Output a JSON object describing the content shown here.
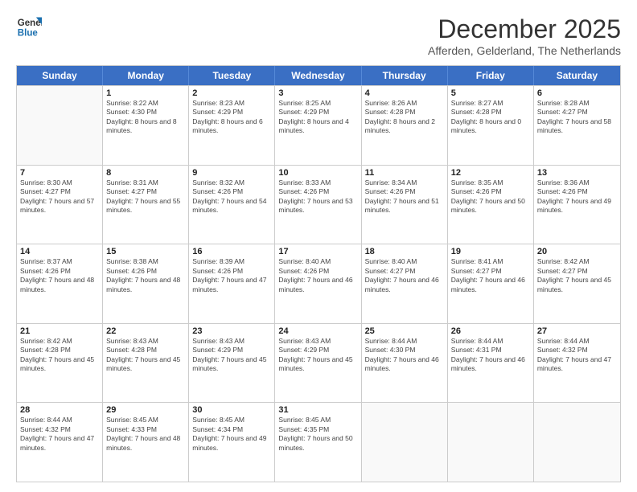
{
  "logo": {
    "line1": "General",
    "line2": "Blue"
  },
  "title": "December 2025",
  "subtitle": "Afferden, Gelderland, The Netherlands",
  "days_of_week": [
    "Sunday",
    "Monday",
    "Tuesday",
    "Wednesday",
    "Thursday",
    "Friday",
    "Saturday"
  ],
  "weeks": [
    [
      {
        "day": "",
        "empty": true
      },
      {
        "day": "1",
        "sunrise": "Sunrise: 8:22 AM",
        "sunset": "Sunset: 4:30 PM",
        "daylight": "Daylight: 8 hours and 8 minutes."
      },
      {
        "day": "2",
        "sunrise": "Sunrise: 8:23 AM",
        "sunset": "Sunset: 4:29 PM",
        "daylight": "Daylight: 8 hours and 6 minutes."
      },
      {
        "day": "3",
        "sunrise": "Sunrise: 8:25 AM",
        "sunset": "Sunset: 4:29 PM",
        "daylight": "Daylight: 8 hours and 4 minutes."
      },
      {
        "day": "4",
        "sunrise": "Sunrise: 8:26 AM",
        "sunset": "Sunset: 4:28 PM",
        "daylight": "Daylight: 8 hours and 2 minutes."
      },
      {
        "day": "5",
        "sunrise": "Sunrise: 8:27 AM",
        "sunset": "Sunset: 4:28 PM",
        "daylight": "Daylight: 8 hours and 0 minutes."
      },
      {
        "day": "6",
        "sunrise": "Sunrise: 8:28 AM",
        "sunset": "Sunset: 4:27 PM",
        "daylight": "Daylight: 7 hours and 58 minutes."
      }
    ],
    [
      {
        "day": "7",
        "sunrise": "Sunrise: 8:30 AM",
        "sunset": "Sunset: 4:27 PM",
        "daylight": "Daylight: 7 hours and 57 minutes."
      },
      {
        "day": "8",
        "sunrise": "Sunrise: 8:31 AM",
        "sunset": "Sunset: 4:27 PM",
        "daylight": "Daylight: 7 hours and 55 minutes."
      },
      {
        "day": "9",
        "sunrise": "Sunrise: 8:32 AM",
        "sunset": "Sunset: 4:26 PM",
        "daylight": "Daylight: 7 hours and 54 minutes."
      },
      {
        "day": "10",
        "sunrise": "Sunrise: 8:33 AM",
        "sunset": "Sunset: 4:26 PM",
        "daylight": "Daylight: 7 hours and 53 minutes."
      },
      {
        "day": "11",
        "sunrise": "Sunrise: 8:34 AM",
        "sunset": "Sunset: 4:26 PM",
        "daylight": "Daylight: 7 hours and 51 minutes."
      },
      {
        "day": "12",
        "sunrise": "Sunrise: 8:35 AM",
        "sunset": "Sunset: 4:26 PM",
        "daylight": "Daylight: 7 hours and 50 minutes."
      },
      {
        "day": "13",
        "sunrise": "Sunrise: 8:36 AM",
        "sunset": "Sunset: 4:26 PM",
        "daylight": "Daylight: 7 hours and 49 minutes."
      }
    ],
    [
      {
        "day": "14",
        "sunrise": "Sunrise: 8:37 AM",
        "sunset": "Sunset: 4:26 PM",
        "daylight": "Daylight: 7 hours and 48 minutes."
      },
      {
        "day": "15",
        "sunrise": "Sunrise: 8:38 AM",
        "sunset": "Sunset: 4:26 PM",
        "daylight": "Daylight: 7 hours and 48 minutes."
      },
      {
        "day": "16",
        "sunrise": "Sunrise: 8:39 AM",
        "sunset": "Sunset: 4:26 PM",
        "daylight": "Daylight: 7 hours and 47 minutes."
      },
      {
        "day": "17",
        "sunrise": "Sunrise: 8:40 AM",
        "sunset": "Sunset: 4:26 PM",
        "daylight": "Daylight: 7 hours and 46 minutes."
      },
      {
        "day": "18",
        "sunrise": "Sunrise: 8:40 AM",
        "sunset": "Sunset: 4:27 PM",
        "daylight": "Daylight: 7 hours and 46 minutes."
      },
      {
        "day": "19",
        "sunrise": "Sunrise: 8:41 AM",
        "sunset": "Sunset: 4:27 PM",
        "daylight": "Daylight: 7 hours and 46 minutes."
      },
      {
        "day": "20",
        "sunrise": "Sunrise: 8:42 AM",
        "sunset": "Sunset: 4:27 PM",
        "daylight": "Daylight: 7 hours and 45 minutes."
      }
    ],
    [
      {
        "day": "21",
        "sunrise": "Sunrise: 8:42 AM",
        "sunset": "Sunset: 4:28 PM",
        "daylight": "Daylight: 7 hours and 45 minutes."
      },
      {
        "day": "22",
        "sunrise": "Sunrise: 8:43 AM",
        "sunset": "Sunset: 4:28 PM",
        "daylight": "Daylight: 7 hours and 45 minutes."
      },
      {
        "day": "23",
        "sunrise": "Sunrise: 8:43 AM",
        "sunset": "Sunset: 4:29 PM",
        "daylight": "Daylight: 7 hours and 45 minutes."
      },
      {
        "day": "24",
        "sunrise": "Sunrise: 8:43 AM",
        "sunset": "Sunset: 4:29 PM",
        "daylight": "Daylight: 7 hours and 45 minutes."
      },
      {
        "day": "25",
        "sunrise": "Sunrise: 8:44 AM",
        "sunset": "Sunset: 4:30 PM",
        "daylight": "Daylight: 7 hours and 46 minutes."
      },
      {
        "day": "26",
        "sunrise": "Sunrise: 8:44 AM",
        "sunset": "Sunset: 4:31 PM",
        "daylight": "Daylight: 7 hours and 46 minutes."
      },
      {
        "day": "27",
        "sunrise": "Sunrise: 8:44 AM",
        "sunset": "Sunset: 4:32 PM",
        "daylight": "Daylight: 7 hours and 47 minutes."
      }
    ],
    [
      {
        "day": "28",
        "sunrise": "Sunrise: 8:44 AM",
        "sunset": "Sunset: 4:32 PM",
        "daylight": "Daylight: 7 hours and 47 minutes."
      },
      {
        "day": "29",
        "sunrise": "Sunrise: 8:45 AM",
        "sunset": "Sunset: 4:33 PM",
        "daylight": "Daylight: 7 hours and 48 minutes."
      },
      {
        "day": "30",
        "sunrise": "Sunrise: 8:45 AM",
        "sunset": "Sunset: 4:34 PM",
        "daylight": "Daylight: 7 hours and 49 minutes."
      },
      {
        "day": "31",
        "sunrise": "Sunrise: 8:45 AM",
        "sunset": "Sunset: 4:35 PM",
        "daylight": "Daylight: 7 hours and 50 minutes."
      },
      {
        "day": "",
        "empty": true
      },
      {
        "day": "",
        "empty": true
      },
      {
        "day": "",
        "empty": true
      }
    ]
  ]
}
